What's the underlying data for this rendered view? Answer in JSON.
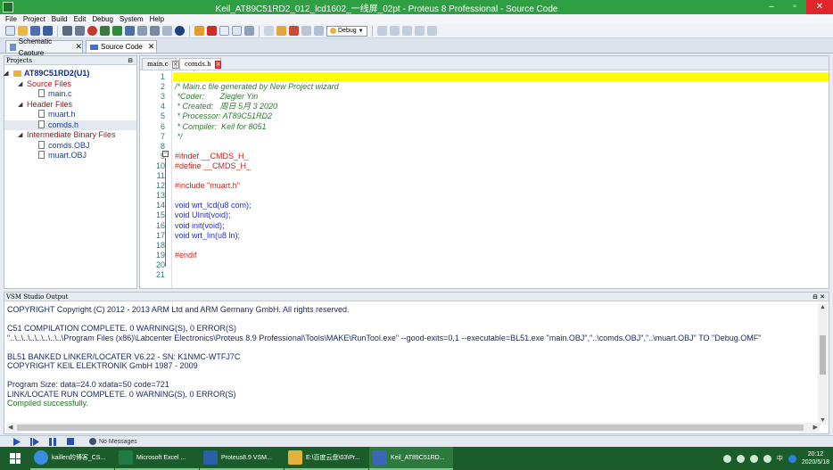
{
  "window": {
    "title": "Keil_AT89C51RD2_012_lcd1602_一线屏_02pt - Proteus 8 Professional - Source Code",
    "min": "–",
    "max": "▫",
    "close": "✕"
  },
  "menu": [
    "File",
    "Project",
    "Build",
    "Edit",
    "Debug",
    "System",
    "Help"
  ],
  "toolbar": {
    "config_value": "Debug",
    "icons": [
      "new-file-icon",
      "open-icon",
      "save-icon",
      "save-all-icon",
      "build-icon",
      "rebuild-icon",
      "stop-icon",
      "step-back-icon",
      "step-icon",
      "run-icon",
      "debug-icon",
      "help-icon",
      "cut-icon",
      "delete-icon",
      "copy-icon",
      "paste-icon",
      "print-icon",
      "undo-icon",
      "redo-icon",
      "find-icon",
      "find-next-icon",
      "replace-icon",
      "goto-icon",
      "bookmark-icon"
    ]
  },
  "tabs": [
    {
      "label": "Schematic Capture",
      "close": "✕"
    },
    {
      "label": "Source Code",
      "close": "✕"
    }
  ],
  "projects": {
    "header": "Projects",
    "pin": "⊟",
    "tree": [
      {
        "label": "AT89C51RD2(U1)",
        "kind": "root"
      },
      {
        "label": "Source Files",
        "kind": "group"
      },
      {
        "label": "main.c",
        "kind": "file"
      },
      {
        "label": "Header Files",
        "kind": "group"
      },
      {
        "label": "muart.h",
        "kind": "file"
      },
      {
        "label": "comds.h",
        "kind": "file"
      },
      {
        "label": "Intermediate Binary Files",
        "kind": "group"
      },
      {
        "label": "comds.OBJ",
        "kind": "file"
      },
      {
        "label": "muart.OBJ",
        "kind": "file"
      }
    ]
  },
  "editor": {
    "tabs": [
      {
        "label": "main.c",
        "close": "×"
      },
      {
        "label": "comds.h",
        "close": "×"
      }
    ],
    "fold_marker": "−",
    "lines": [
      {
        "n": "1",
        "text": "",
        "cls": ""
      },
      {
        "n": "2",
        "text": "/* Main.c file generated by New Project wizard",
        "cls": "cm"
      },
      {
        "n": "3",
        "text": " *Coder:       Ziegler Yin",
        "cls": "cm"
      },
      {
        "n": "4",
        "text": " * Created:   周日 5月 3 2020",
        "cls": "cm"
      },
      {
        "n": "5",
        "text": " * Processor: AT89C51RD2",
        "cls": "cm"
      },
      {
        "n": "6",
        "text": " * Compiler:  Keil for 8051",
        "cls": "cm"
      },
      {
        "n": "7",
        "text": " */",
        "cls": "cm"
      },
      {
        "n": "8",
        "text": "",
        "cls": ""
      },
      {
        "n": "9",
        "text": "#ifndef __CMDS_H_",
        "cls": "pp"
      },
      {
        "n": "10",
        "text": "#define __CMDS_H_",
        "cls": "pp"
      },
      {
        "n": "11",
        "text": "",
        "cls": ""
      },
      {
        "n": "12",
        "text": "#include \"muart.h\"",
        "cls": "pp"
      },
      {
        "n": "13",
        "text": "",
        "cls": ""
      },
      {
        "n": "14",
        "text": "void wrt_lcd(u8 com);",
        "cls": "kw"
      },
      {
        "n": "15",
        "text": "void UInit(void);",
        "cls": "kw"
      },
      {
        "n": "16",
        "text": "void init(void);",
        "cls": "kw"
      },
      {
        "n": "17",
        "text": "void wrt_lin(u8 ln);",
        "cls": "kw"
      },
      {
        "n": "18",
        "text": "",
        "cls": ""
      },
      {
        "n": "19",
        "text": "#endif",
        "cls": "pp"
      },
      {
        "n": "20",
        "text": "",
        "cls": ""
      },
      {
        "n": "21",
        "text": "",
        "cls": ""
      }
    ]
  },
  "output": {
    "header": "VSM Studio Output",
    "pin": "⊟ ✕",
    "lines": [
      {
        "text": "COPYRIGHT Copyright (C) 2012 - 2013 ARM Ltd and ARM Germany GmbH. All rights reserved.",
        "cls": ""
      },
      {
        "text": "",
        "cls": ""
      },
      {
        "text": "C51 COMPILATION COMPLETE.  0 WARNING(S),  0 ERROR(S)",
        "cls": ""
      },
      {
        "text": "\"..\\..\\..\\..\\..\\..\\..\\..\\Program Files (x86)\\Labcenter Electronics\\Proteus 8.9 Professional\\Tools\\MAKE\\RunTool.exe\" --good-exits=0,1 --executable=BL51.exe \"main.OBJ\",\"..\\comds.OBJ\",\"..\\muart.OBJ\" TO \"Debug.OMF\"",
        "cls": ""
      },
      {
        "text": "",
        "cls": ""
      },
      {
        "text": "BL51 BANKED LINKER/LOCATER V6.22 - SN: K1NMC-WTFJ7C",
        "cls": ""
      },
      {
        "text": "COPYRIGHT KEIL ELEKTRONIK GmbH 1987 - 2009",
        "cls": ""
      },
      {
        "text": "",
        "cls": ""
      },
      {
        "text": "Program Size: data=24.0 xdata=50 code=721",
        "cls": ""
      },
      {
        "text": "LINK/LOCATE RUN COMPLETE.  0 WARNING(S),  0 ERROR(S)",
        "cls": ""
      },
      {
        "text": "Compiled successfully.",
        "cls": "green"
      }
    ]
  },
  "simbar": {
    "messages": "No Messages"
  },
  "taskbar": {
    "tasks": [
      {
        "label": "kaillen的博客_CS...",
        "color": "#3b8de0"
      },
      {
        "label": "Microsoft Excel ...",
        "color": "#1f7a45"
      },
      {
        "label": "Proteus8.9 VSM...",
        "color": "#2b5fa8"
      },
      {
        "label": "E:\\百度云盘\\03\\Pr...",
        "color": "#e2b23a"
      },
      {
        "label": "Keil_AT89C51RD...",
        "color": "#3d66b8"
      }
    ],
    "time": "20:12",
    "date": "2020/5/18",
    "lang": "中",
    "tray_icons": [
      "bluetooth-icon",
      "shield-icon",
      "wifi-icon",
      "volume-icon",
      "ime-icon"
    ]
  }
}
